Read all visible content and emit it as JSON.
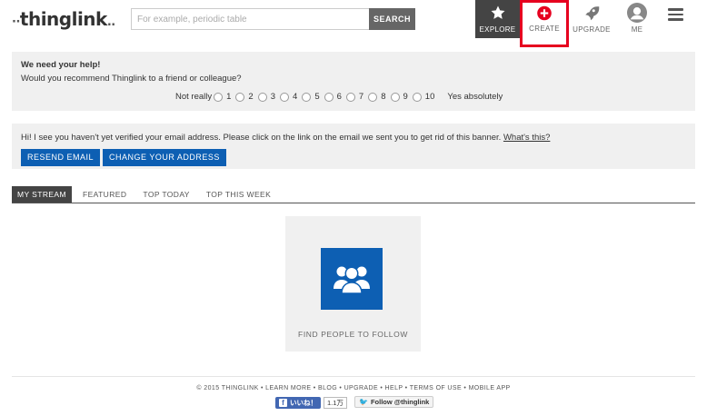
{
  "header": {
    "logo_text": "thinglink",
    "search": {
      "placeholder": "For example, periodic table",
      "button": "SEARCH"
    },
    "nav": [
      {
        "label": "EXPLORE",
        "icon": "star-icon"
      },
      {
        "label": "CREATE",
        "icon": "plus-circle-icon"
      },
      {
        "label": "UPGRADE",
        "icon": "rocket-icon"
      },
      {
        "label": "ME",
        "icon": "avatar-icon"
      }
    ],
    "menu_icon": "hamburger-menu-icon"
  },
  "survey": {
    "title": "We need your help!",
    "question": "Would you recommend Thinglink to a friend or colleague?",
    "low_label": "Not really",
    "high_label": "Yes absolutely",
    "options": [
      "1",
      "2",
      "3",
      "4",
      "5",
      "6",
      "7",
      "8",
      "9",
      "10"
    ]
  },
  "verify": {
    "message": "Hi! I see you haven't yet verified your email address. Please click on the link on the email we sent you to get rid of this banner.",
    "link": "What's this?",
    "resend": "RESEND EMAIL",
    "change": "CHANGE YOUR ADDRESS"
  },
  "tabs": [
    "MY STREAM",
    "FEATURED",
    "TOP TODAY",
    "TOP THIS WEEK"
  ],
  "card": {
    "label": "FIND PEOPLE TO FOLLOW",
    "icon": "people-group-icon"
  },
  "footer": {
    "links": "© 2015 THINGLINK • LEARN MORE • BLOG • UPGRADE • HELP • TERMS OF USE • MOBILE APP",
    "fb_like": "いいね！",
    "fb_count": "1.1万",
    "twitter_follow": "Follow @thinglink"
  },
  "colors": {
    "accent_blue": "#0d5fb3",
    "highlight_red": "#e6001f",
    "explore_bg": "#444444"
  }
}
